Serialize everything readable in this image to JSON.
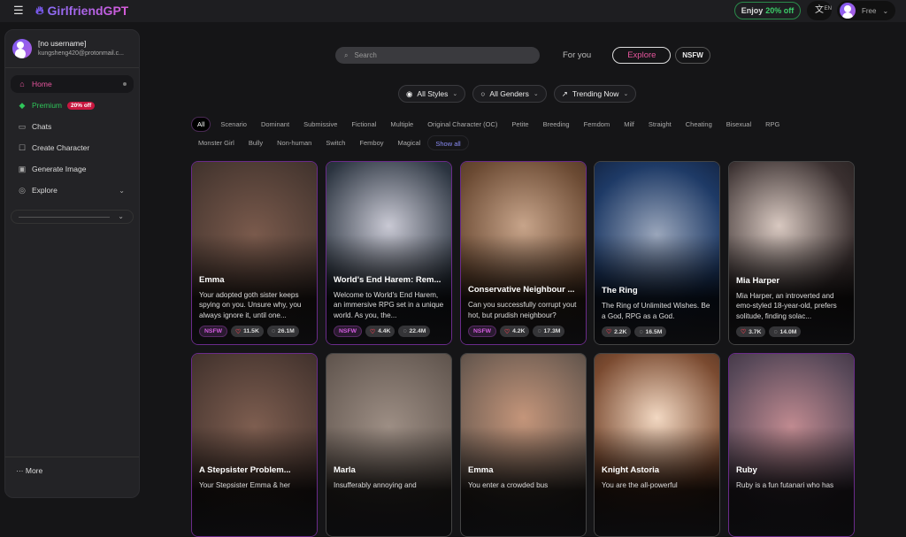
{
  "header": {
    "brand": "GirlfriendGPT",
    "promo_prefix": "Enjoy",
    "promo_value": "20% off",
    "lang": "EN",
    "plan": "Free"
  },
  "sidebar": {
    "username": "[no username]",
    "email": "kungsheng420@protonmail.c...",
    "items": [
      {
        "label": "Home",
        "icon": "home-icon"
      },
      {
        "label": "Premium",
        "icon": "diamond-icon",
        "badge": "20% off"
      },
      {
        "label": "Chats",
        "icon": "chat-icon"
      },
      {
        "label": "Create Character",
        "icon": "robot-icon"
      },
      {
        "label": "Generate Image",
        "icon": "image-icon"
      },
      {
        "label": "Explore",
        "icon": "compass-icon"
      }
    ],
    "more": "More"
  },
  "search": {
    "placeholder": "Search"
  },
  "tabs": {
    "for_you": "For you",
    "explore": "Explore",
    "nsfw": "NSFW"
  },
  "filters": {
    "styles": "All Styles",
    "genders": "All Genders",
    "sort": "Trending Now"
  },
  "tags": [
    "All",
    "Scenario",
    "Dominant",
    "Submissive",
    "Fictional",
    "Multiple",
    "Original Character (OC)",
    "Petite",
    "Breeding",
    "Femdom",
    "Milf",
    "Straight",
    "Cheating",
    "Bisexual",
    "RPG",
    "Monster Girl",
    "Bully",
    "Non-human",
    "Switch",
    "Femboy",
    "Magical",
    "Show all"
  ],
  "cards": [
    {
      "title": "Emma",
      "desc": "Your adopted goth sister keeps spying on you. Unsure why, you always ignore it, until one...",
      "nsfw": "NSFW",
      "likes": "11.5K",
      "chats": "26.1M"
    },
    {
      "title": "World's End Harem: Rem...",
      "desc": "Welcome to World's End Harem, an immersive RPG set in a unique world. As you, the...",
      "nsfw": "NSFW",
      "likes": "4.4K",
      "chats": "22.4M"
    },
    {
      "title": "Conservative Neighbour ...",
      "desc": "Can you successfully corrupt yout hot, but prudish neighbour?",
      "nsfw": "NSFW",
      "likes": "4.2K",
      "chats": "17.3M"
    },
    {
      "title": "The Ring",
      "desc": "The Ring of Unlimited Wishes. Be a God, RPG as a God.",
      "likes": "2.2K",
      "chats": "16.5M"
    },
    {
      "title": "Mia Harper",
      "desc": "Mia Harper, an introverted and emo-styled 18-year-old, prefers solitude, finding solac...",
      "likes": "3.7K",
      "chats": "14.0M"
    },
    {
      "title": "A Stepsister Problem...",
      "desc": "Your Stepsister Emma & her"
    },
    {
      "title": "Marla",
      "desc": "Insufferably annoying and"
    },
    {
      "title": "Emma",
      "desc": "You enter a crowded bus"
    },
    {
      "title": "Knight Astoria",
      "desc": "You are the all-powerful"
    },
    {
      "title": "Ruby",
      "desc": "Ruby is a fun futanari who has"
    }
  ]
}
